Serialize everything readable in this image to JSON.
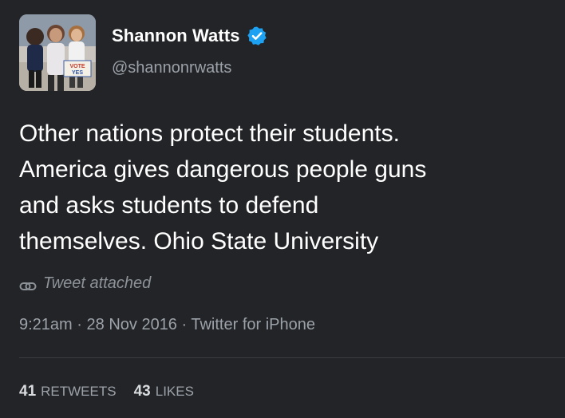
{
  "tweet": {
    "display_name": "Shannon Watts",
    "handle": "@shannonrwatts",
    "verified": true,
    "text": "Other nations protect their students.\nAmerica gives dangerous people guns\nand asks students to defend\nthemselves. Ohio State University",
    "attachment_label": "Tweet attached",
    "time": "9:21am",
    "date": "28 Nov 2016",
    "source": "Twitter for iPhone",
    "separator": "·",
    "retweets_count": "41",
    "retweets_label": "RETWEETS",
    "likes_count": "43",
    "likes_label": "LIKES"
  },
  "avatar": {
    "sign_text_1": "VOTE",
    "sign_text_2": "YES"
  },
  "colors": {
    "background": "#232427",
    "text_primary": "#ffffff",
    "text_secondary": "#9ca2a9",
    "verified_blue": "#1da1f2"
  },
  "icons": {
    "verified": "verified-badge-icon",
    "attachment": "link-icon"
  }
}
